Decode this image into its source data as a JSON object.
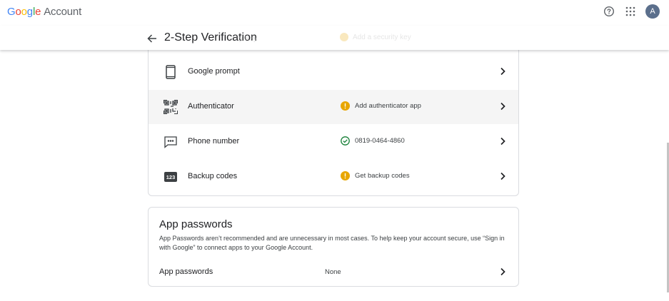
{
  "header": {
    "logo_letters": [
      "G",
      "o",
      "o",
      "g",
      "l",
      "e"
    ],
    "logo_suffix": "Account",
    "avatar_letter": "A",
    "icons": [
      "help-icon",
      "apps-grid-icon"
    ]
  },
  "subheader": {
    "title": "2-Step Verification",
    "ghost_left_text": "ity Key",
    "ghost_status_text": "Add a security key"
  },
  "methods": [
    {
      "label": "Google prompt",
      "icon": "phone-icon",
      "status": "",
      "status_type": ""
    },
    {
      "label": "Authenticator",
      "icon": "qr-code-icon",
      "status": "Add authenticator app",
      "status_type": "warning"
    },
    {
      "label": "Phone number",
      "icon": "message-icon",
      "status": "0819-0464-4860",
      "status_type": "ok"
    },
    {
      "label": "Backup codes",
      "icon": "backup-codes-icon",
      "icon_text": "123",
      "status": "Get backup codes",
      "status_type": "warning"
    }
  ],
  "app_passwords": {
    "title": "App passwords",
    "description": "App Passwords aren’t recommended and are unnecessary in most cases. To help keep your account secure, use “Sign in with Google” to connect apps to your Google Account.",
    "row_label": "App passwords",
    "row_value": "None"
  },
  "colors": {
    "warning": "#e8a600",
    "ok": "#188038",
    "avatar": "#5b6f8c",
    "highlight": "#f5f5f5"
  }
}
